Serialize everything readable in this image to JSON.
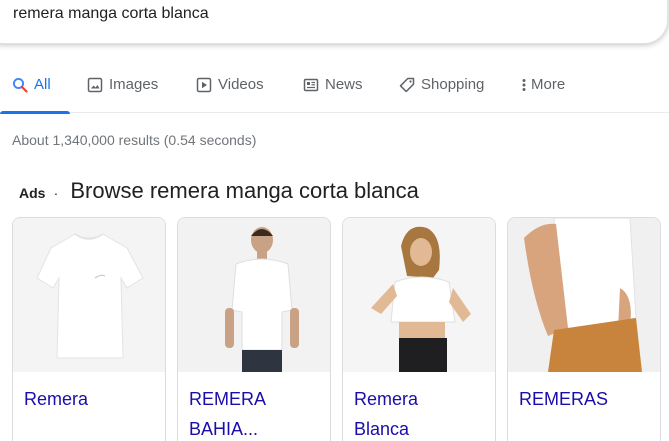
{
  "search": {
    "query": "remera manga corta blanca"
  },
  "tabs": [
    {
      "label": "All",
      "icon": "search-icon",
      "active": true
    },
    {
      "label": "Images",
      "icon": "image-icon"
    },
    {
      "label": "Videos",
      "icon": "play-icon"
    },
    {
      "label": "News",
      "icon": "news-icon"
    },
    {
      "label": "Shopping",
      "icon": "tag-icon"
    },
    {
      "label": "More",
      "icon": "more-vert-icon"
    }
  ],
  "stats": "About 1,340,000 results (0.54 seconds)",
  "ads": {
    "label": "Ads",
    "separator": "·",
    "heading": "Browse remera manga corta blanca",
    "products": [
      {
        "title_lines": [
          "Remera"
        ]
      },
      {
        "title_lines": [
          "REMERA",
          "BAHIA..."
        ]
      },
      {
        "title_lines": [
          "Remera",
          "Blanca"
        ]
      },
      {
        "title_lines": [
          "REMERAS"
        ]
      }
    ]
  },
  "colors": {
    "accent": "#1a73e8",
    "link": "#1a0dab",
    "muted": "#70757a",
    "tab_text": "#5f6368"
  }
}
